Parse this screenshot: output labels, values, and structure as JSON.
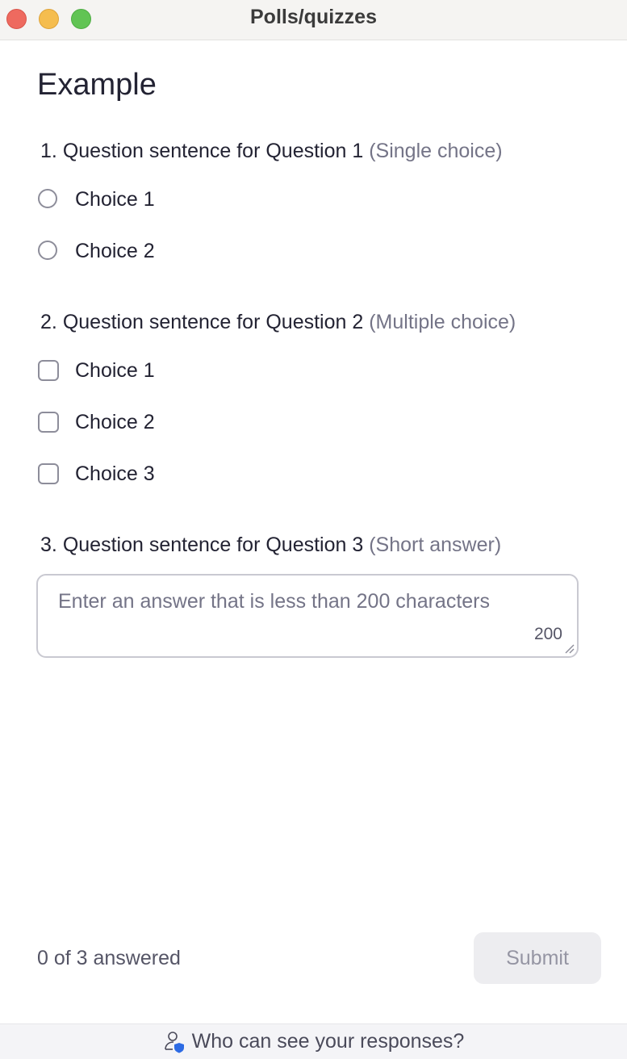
{
  "window": {
    "title": "Polls/quizzes"
  },
  "poll": {
    "title": "Example",
    "questions": [
      {
        "number": "1.",
        "text": "Question sentence for Question 1",
        "type": "(Single choice)",
        "choices": [
          "Choice 1",
          "Choice 2"
        ]
      },
      {
        "number": "2.",
        "text": "Question sentence for Question 2",
        "type": "(Multiple choice)",
        "choices": [
          "Choice 1",
          "Choice 2",
          "Choice 3"
        ]
      },
      {
        "number": "3.",
        "text": "Question sentence for Question 3",
        "type": "(Short answer)",
        "answer_placeholder": "Enter an answer that is less than 200 characters",
        "char_limit": "200"
      }
    ]
  },
  "footer": {
    "answered": "0 of 3 answered",
    "submit_label": "Submit",
    "privacy_link": "Who can see your responses?"
  },
  "colors": {
    "close": "#ee6a5f",
    "minimize": "#f5bd4f",
    "maximize": "#61c454",
    "privacy_icon_accent": "#2d6be4"
  },
  "icons": [
    "radio-button-icon",
    "checkbox-icon",
    "resize-grip-icon",
    "user-shield-icon"
  ]
}
